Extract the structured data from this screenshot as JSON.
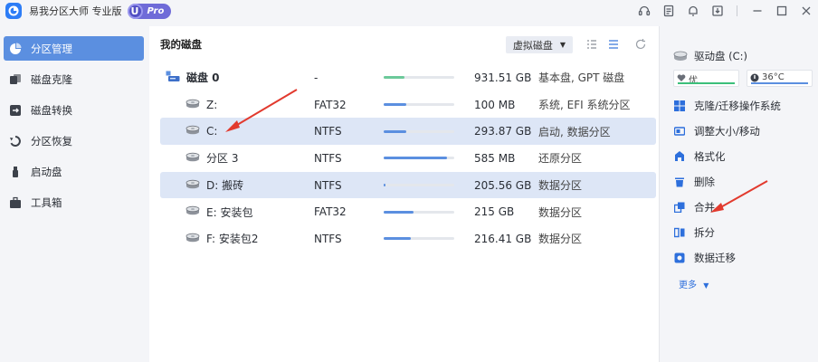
{
  "app": {
    "title": "易我分区大师 专业版",
    "badge_letter": "U",
    "badge_label": "Pro"
  },
  "titlebar_icons": [
    "headset-icon",
    "notes-icon",
    "bell-icon",
    "download-icon",
    "minimize-icon",
    "maximize-icon",
    "close-icon"
  ],
  "sidebar": {
    "items": [
      {
        "label": "分区管理",
        "icon": "pie-chart-icon",
        "active": true
      },
      {
        "label": "磁盘克隆",
        "icon": "clone-icon",
        "active": false
      },
      {
        "label": "磁盘转换",
        "icon": "convert-icon",
        "active": false
      },
      {
        "label": "分区恢复",
        "icon": "recover-icon",
        "active": false
      },
      {
        "label": "启动盘",
        "icon": "usb-icon",
        "active": false
      },
      {
        "label": "工具箱",
        "icon": "toolbox-icon",
        "active": false
      }
    ]
  },
  "main": {
    "title": "我的磁盘",
    "virtual_disk_select": "虚拟磁盘",
    "rows": [
      {
        "name": "磁盘 0",
        "fs": "-",
        "usage": 0.3,
        "size": "931.51 GB",
        "type": "基本盘, GPT 磁盘",
        "kind": "disk",
        "selected": false
      },
      {
        "name": "Z:",
        "fs": "FAT32",
        "usage": 0.32,
        "size": "100 MB",
        "type": "系统, EFI 系统分区",
        "kind": "partition",
        "selected": false
      },
      {
        "name": "C:",
        "fs": "NTFS",
        "usage": 0.32,
        "size": "293.87 GB",
        "type": "启动, 数据分区",
        "kind": "partition",
        "selected": true
      },
      {
        "name": "分区 3",
        "fs": "NTFS",
        "usage": 0.9,
        "size": "585 MB",
        "type": "还原分区",
        "kind": "partition",
        "selected": false
      },
      {
        "name": "D: 搬砖",
        "fs": "NTFS",
        "usage": 0.02,
        "size": "205.56 GB",
        "type": "数据分区",
        "kind": "partition",
        "selected": true
      },
      {
        "name": "E: 安装包",
        "fs": "FAT32",
        "usage": 0.42,
        "size": "215 GB",
        "type": "数据分区",
        "kind": "partition",
        "selected": false
      },
      {
        "name": "F: 安装包2",
        "fs": "NTFS",
        "usage": 0.38,
        "size": "216.41 GB",
        "type": "数据分区",
        "kind": "partition",
        "selected": false
      }
    ]
  },
  "right_panel": {
    "drive_label": "驱动盘 (C:)",
    "health_label": "优",
    "temp_label": "36°C",
    "colors": {
      "health": "#3cbf7a",
      "temp": "#5b8fe0",
      "accent": "#2d6fdc",
      "active_nav": "#5b8fe0",
      "arrow": "#e23a2e"
    },
    "operations": [
      {
        "label": "克隆/迁移操作系统",
        "icon": "windows-icon"
      },
      {
        "label": "调整大小/移动",
        "icon": "resize-icon"
      },
      {
        "label": "格式化",
        "icon": "format-icon"
      },
      {
        "label": "删除",
        "icon": "trash-icon"
      },
      {
        "label": "合并",
        "icon": "merge-icon"
      },
      {
        "label": "拆分",
        "icon": "split-icon"
      },
      {
        "label": "数据迁移",
        "icon": "migrate-icon"
      }
    ],
    "more_label": "更多"
  }
}
